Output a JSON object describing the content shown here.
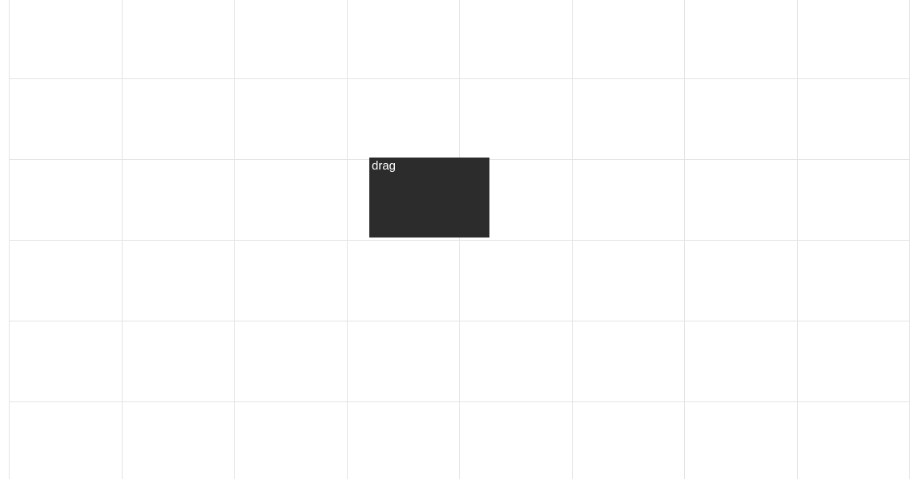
{
  "grid": {
    "rows": 6,
    "cols": 8
  },
  "drag": {
    "label": "drag",
    "row": 2,
    "col": 3
  }
}
